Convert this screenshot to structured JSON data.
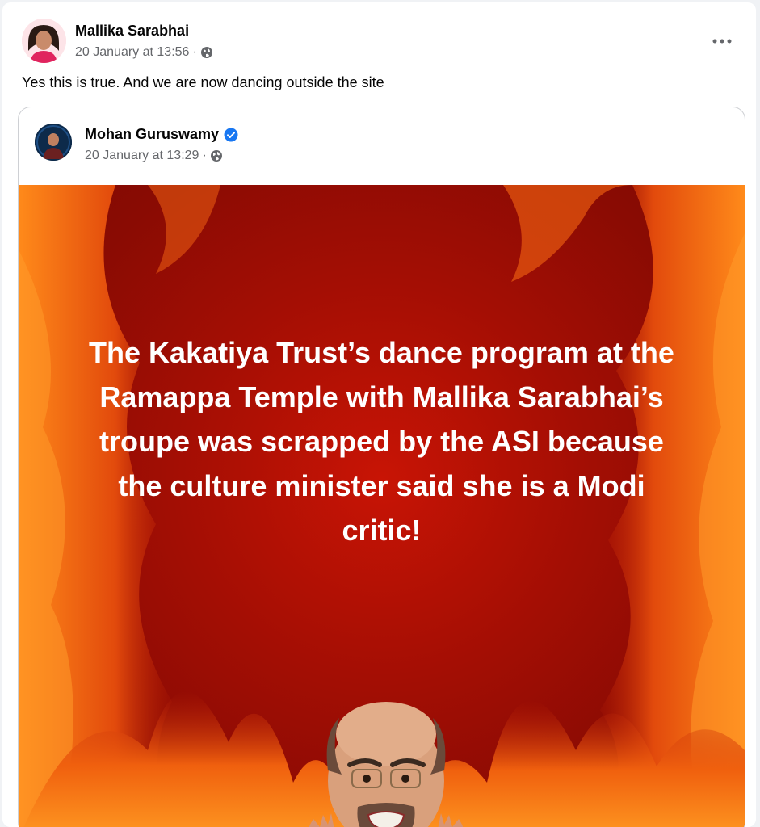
{
  "post": {
    "author": "Mallika Sarabhai",
    "date": "20 January at 13:56",
    "separator": "·",
    "privacy_icon": "globe-icon",
    "text": "Yes this is true. And we are now dancing outside the site",
    "more_icon": "more-options-icon"
  },
  "shared_post": {
    "author": "Mohan Guruswamy",
    "verified_icon": "verified-badge-icon",
    "date": "20 January at 13:29",
    "separator": "·",
    "privacy_icon": "globe-icon",
    "image_text_lines": [
      "The Kakatiya Trust’s dance program at the",
      "Ramappa Temple with Mallika Sarabhai’s",
      "troupe was scrapped by the ASI because",
      "the culture minister said she is a Modi",
      "critic!"
    ]
  },
  "colors": {
    "name_text": "#050505",
    "meta_text": "#65676b",
    "verified_blue": "#1877f2",
    "panel_red": "#a30e04",
    "flame_orange": "#f36a10"
  }
}
